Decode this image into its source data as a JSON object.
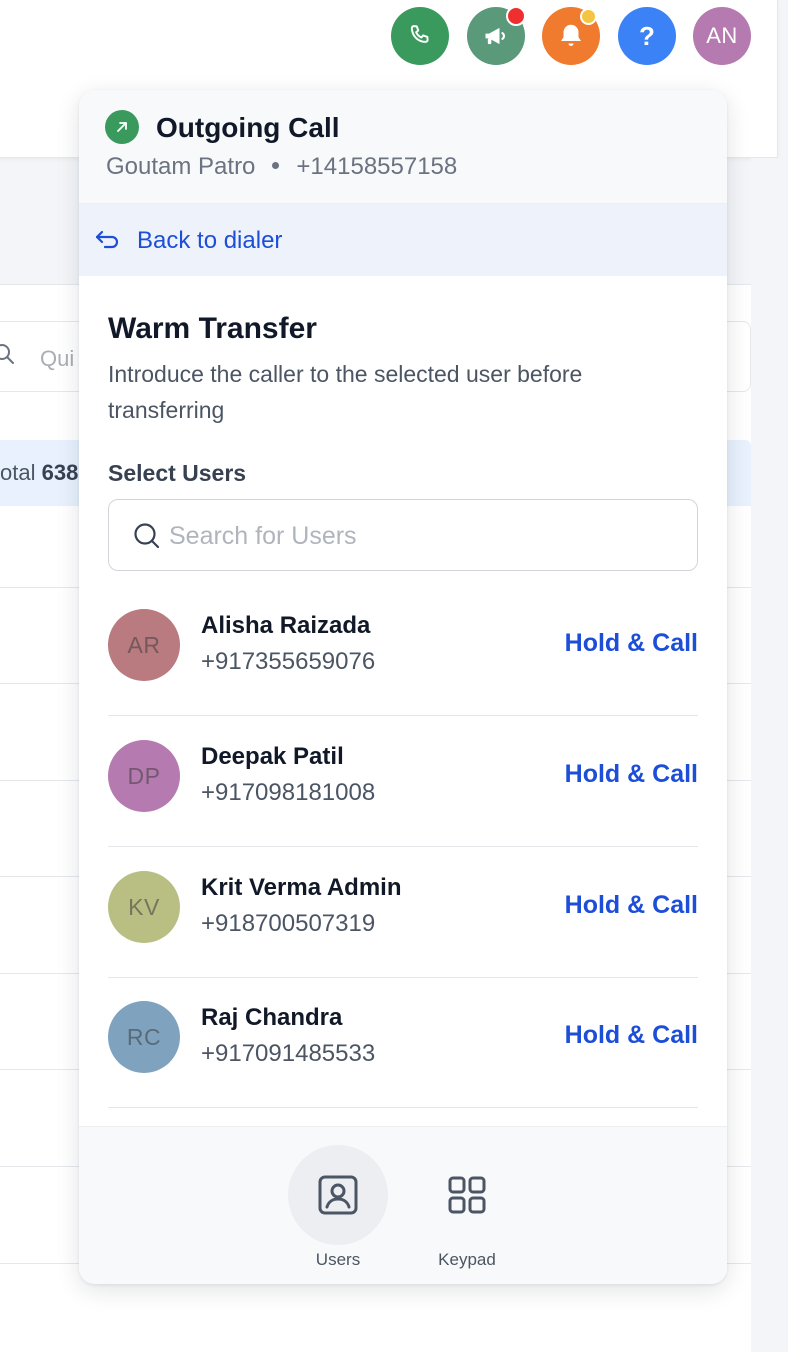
{
  "background": {
    "search_placeholder": "Qui",
    "total_label": "otal",
    "total_value": "638"
  },
  "topbar": {
    "icons": [
      "phone-icon",
      "megaphone-icon",
      "bell-icon",
      "help-icon"
    ],
    "help_glyph": "?",
    "avatar_initials": "AN",
    "colors": {
      "phone": "#3a9a5d",
      "megaphone": "#5a9a7a",
      "bell": "#f07a2e",
      "help": "#3b82f6",
      "avatar": "#b57ab0",
      "red_dot": "#ef2f2f",
      "yellow_dot": "#f5c542"
    }
  },
  "call": {
    "status_title": "Outgoing Call",
    "caller_name": "Goutam Patro",
    "caller_number": "+14158557158"
  },
  "back": {
    "label": "Back to dialer"
  },
  "warm_transfer": {
    "title": "Warm Transfer",
    "description": "Introduce the caller to the selected user before transferring",
    "select_label": "Select Users",
    "search_placeholder": "Search for Users"
  },
  "users": [
    {
      "initials": "AR",
      "name": "Alisha Raizada",
      "phone": "+917355659076",
      "action": "Hold & Call",
      "avatar_color": "#b97a80"
    },
    {
      "initials": "DP",
      "name": "Deepak Patil",
      "phone": "+917098181008",
      "action": "Hold & Call",
      "avatar_color": "#b57ab0"
    },
    {
      "initials": "KV",
      "name": "Krit Verma Admin",
      "phone": "+918700507319",
      "action": "Hold & Call",
      "avatar_color": "#b9bf82"
    },
    {
      "initials": "RC",
      "name": "Raj Chandra",
      "phone": "+917091485533",
      "action": "Hold & Call",
      "avatar_color": "#7fa3bf"
    }
  ],
  "footer": {
    "tabs": [
      {
        "label": "Users",
        "icon": "contact-card-icon",
        "active": true
      },
      {
        "label": "Keypad",
        "icon": "grid-icon",
        "active": false
      }
    ]
  }
}
